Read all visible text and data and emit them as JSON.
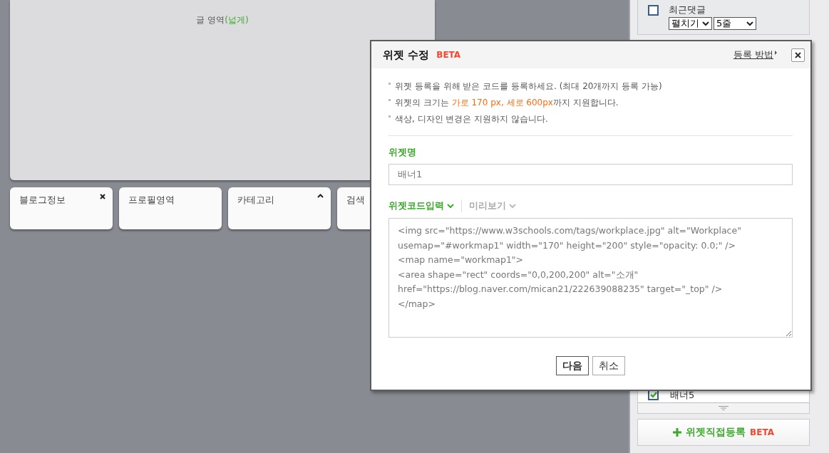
{
  "content_area": {
    "label": "글 영역",
    "label_accent": "(넓게)"
  },
  "widget_cards": [
    {
      "title": "블로그정보",
      "kind": "removable"
    },
    {
      "title": "프로필영역",
      "kind": "plain"
    },
    {
      "title": "카테고리",
      "kind": "collapsible"
    },
    {
      "title": "검색",
      "kind": "plain"
    }
  ],
  "side_panel": {
    "top_item": {
      "label": "최근댓글",
      "checked": false,
      "selects": [
        "펼치기",
        "5줄"
      ]
    },
    "bottom_item": {
      "label": "배너5",
      "checked": true
    },
    "add_button": {
      "label": "위젯직접등록",
      "badge": "BETA"
    }
  },
  "dialog": {
    "title": "위젯 수정",
    "badge": "BETA",
    "help_link": "등록 방법",
    "notes": [
      "위젯 등록을 위해 받은 코드를 등록하세요. (최대 20개까지 등록 가능)",
      "위젯의 크기는 **가로 170 px, 세로 600px**까지 지원합니다.",
      "색상, 디자인 변경은 지원하지 않습니다."
    ],
    "name_label": "위젯명",
    "name_value": "배너1",
    "tabs": [
      {
        "label": "위젯코드입력",
        "selected": true
      },
      {
        "label": "미리보기",
        "selected": false
      }
    ],
    "code_lines": [
      "<img src=\"https://www.w3schools.com/tags/workplace.jpg\" alt=\"Workplace\"",
      "usemap=\"#workmap1\" width=\"170\" height=\"200\" style=\"opacity: 0.0;\" />",
      "<map name=\"workmap1\">",
      "<area shape=\"rect\" coords=\"0,0,200,200\" alt=\"소개\"",
      "href=\"https://blog.naver.com/mican21/222639088235\" target=\"_top\" />",
      "</map>"
    ],
    "buttons": [
      {
        "label": "다음",
        "kind": "primary"
      },
      {
        "label": "취소",
        "kind": "default"
      }
    ]
  }
}
